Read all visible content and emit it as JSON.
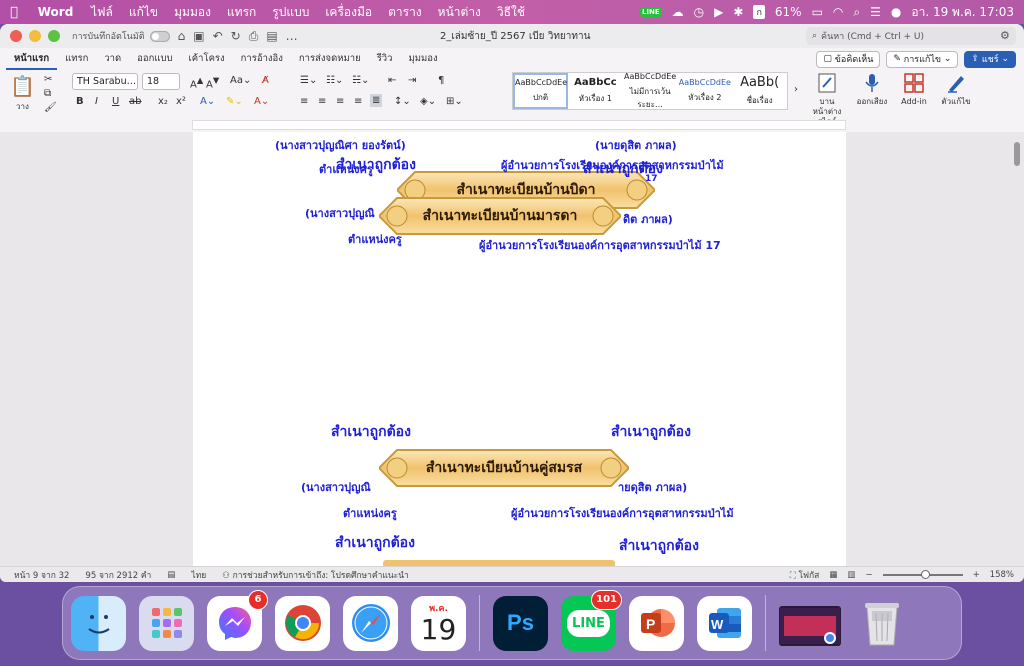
{
  "menubar": {
    "app_name": "Word",
    "items": [
      "ไฟล์",
      "แก้ไข",
      "มุมมอง",
      "แทรก",
      "รูปแบบ",
      "เครื่องมือ",
      "ตาราง",
      "หน้าต่าง",
      "วิธีใช้"
    ],
    "battery": "61%",
    "datetime": "อา. 19 พ.ค.  17:03",
    "line_icon_text": "LINE",
    "input_source": "ก"
  },
  "titlebar": {
    "autosave_label": "การบันทึกอัตโนมัติ",
    "doc_title": "2_เล่มซ้าย_ปี 2567 เบีย วิทยาทาน",
    "search_placeholder": "ค้นหา (Cmd + Ctrl + U)"
  },
  "ribbon_tabs": {
    "tabs": [
      "หน้าแรก",
      "แทรก",
      "วาด",
      "ออกแบบ",
      "เค้าโครง",
      "การอ้างอิง",
      "การส่งจดหมาย",
      "รีวิว",
      "มุมมอง"
    ],
    "comments": "ข้อคิดเห็น",
    "editing": "การแก้ไข",
    "share": "แชร์"
  },
  "ribbon": {
    "paste_label": "วาง",
    "font_name": "TH Sarabu…",
    "font_size": "18",
    "styles": [
      {
        "sample": "AaBbCcDdEe",
        "label": "ปกติ"
      },
      {
        "sample": "AaBbCc",
        "label": "หัวเรื่อง 1"
      },
      {
        "sample": "AaBbCcDdEe",
        "label": "ไม่มีการเว้นระยะ…"
      },
      {
        "sample": "AaBbCcDdEe",
        "label": "หัวเรื่อง 2"
      },
      {
        "sample": "AaBb(",
        "label": "ชื่อเรื่อง"
      }
    ],
    "styles_pane": "บานหน้าต่างสไตล์",
    "dictate": "ออกเสียง",
    "addin": "Add-in",
    "editor": "ตัวแก้ไข"
  },
  "document": {
    "banner1": "สำเนาทะเบียนบ้านบิดา",
    "banner2": "สำเนาทะเบียนบ้านมารดา",
    "banner3": "สำเนาทะเบียนบ้านคู่สมรส",
    "name_teacher_full": "(นางสาวปุญณิศา ยองรัตน์)",
    "name_teacher_partial": "(นางสาวปุญณิ",
    "name_director_full": "(นายดุสิต ภาผล)",
    "name_director_partial": "ดิต ภาผล)",
    "name_director_partial2": "ายดุสิต ภาผล)",
    "position_teacher": "ตำแหน่งครู",
    "position_director": "ผู้อำนวยการโรงเรียนองค์การอุตสาหกรรมป่าไม้",
    "position_director_17": "ผู้อำนวยการโรงเรียนองค์การอุตสาหกรรมป่าไม้ 17",
    "certified": "สำเนาถูกต้อง",
    "digit_17": "17"
  },
  "statusbar": {
    "page": "หน้า 9 จาก 32",
    "words": "95 จาก 2912 คำ",
    "language": "ไทย",
    "accessibility": "การช่วยสำหรับการเข้าถึง: โปรดศึกษาคำแนะนำ",
    "focus": "โฟกัส",
    "zoom": "158%",
    "zoom_level": 0.53
  },
  "dock": {
    "messenger_badge": "6",
    "line_badge": "101",
    "calendar_month": "พ.ค.",
    "calendar_day": "19",
    "ps_label": "Ps",
    "line_label": "LINE"
  }
}
